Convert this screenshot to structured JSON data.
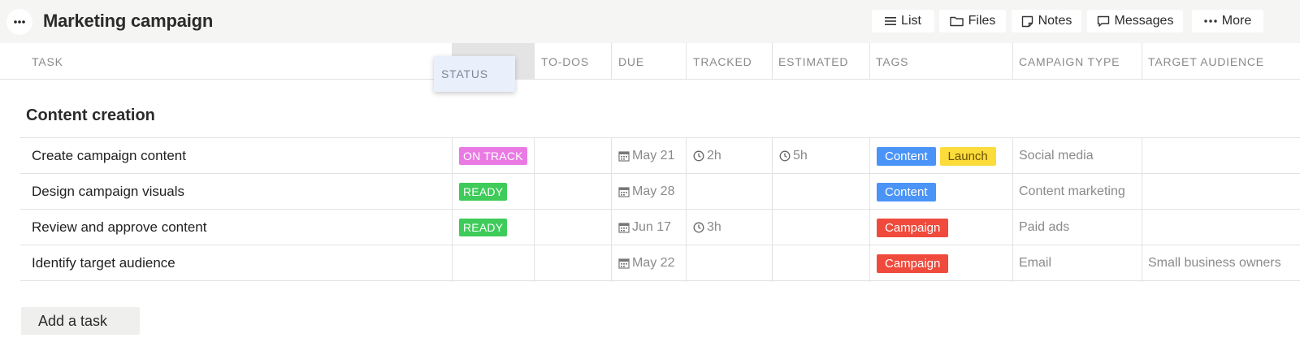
{
  "header": {
    "title": "Marketing campaign",
    "nav": {
      "list": "List",
      "files": "Files",
      "notes": "Notes",
      "messages": "Messages",
      "more": "More"
    }
  },
  "columns": {
    "task": "TASK",
    "status": "STATUS",
    "todos": "TO-DOS",
    "due": "DUE",
    "tracked": "TRACKED",
    "estimated": "ESTIMATED",
    "tags": "TAGS",
    "campaign_type": "CAMPAIGN TYPE",
    "target_audience": "TARGET AUDIENCE"
  },
  "group": {
    "title": "Content creation",
    "add_task": "Add a task",
    "rows": [
      {
        "task": "Create campaign content",
        "status": "ON TRACK",
        "status_color": "#e97ae4",
        "due": "May 21",
        "tracked": "2h",
        "estimated": "5h",
        "tags": [
          {
            "label": "Content",
            "color": "#4a94f7"
          },
          {
            "label": "Launch",
            "color": "#fbdc3b"
          }
        ],
        "campaign_type": "Social media",
        "target_audience": ""
      },
      {
        "task": "Design campaign visuals",
        "status": "READY",
        "status_color": "#3ecb59",
        "due": "May 28",
        "tracked": "",
        "estimated": "",
        "tags": [
          {
            "label": "Content",
            "color": "#4a94f7"
          }
        ],
        "campaign_type": "Content marketing",
        "target_audience": ""
      },
      {
        "task": "Review and approve content",
        "status": "READY",
        "status_color": "#3ecb59",
        "due": "Jun 17",
        "tracked": "3h",
        "estimated": "",
        "tags": [
          {
            "label": "Campaign",
            "color": "#ef4a3c"
          }
        ],
        "campaign_type": "Paid ads",
        "target_audience": ""
      },
      {
        "task": "Identify target audience",
        "status": "",
        "status_color": "",
        "due": "May 22",
        "tracked": "",
        "estimated": "",
        "tags": [
          {
            "label": "Campaign",
            "color": "#ef4a3c"
          }
        ],
        "campaign_type": "Email",
        "target_audience": "Small business owners"
      }
    ]
  }
}
